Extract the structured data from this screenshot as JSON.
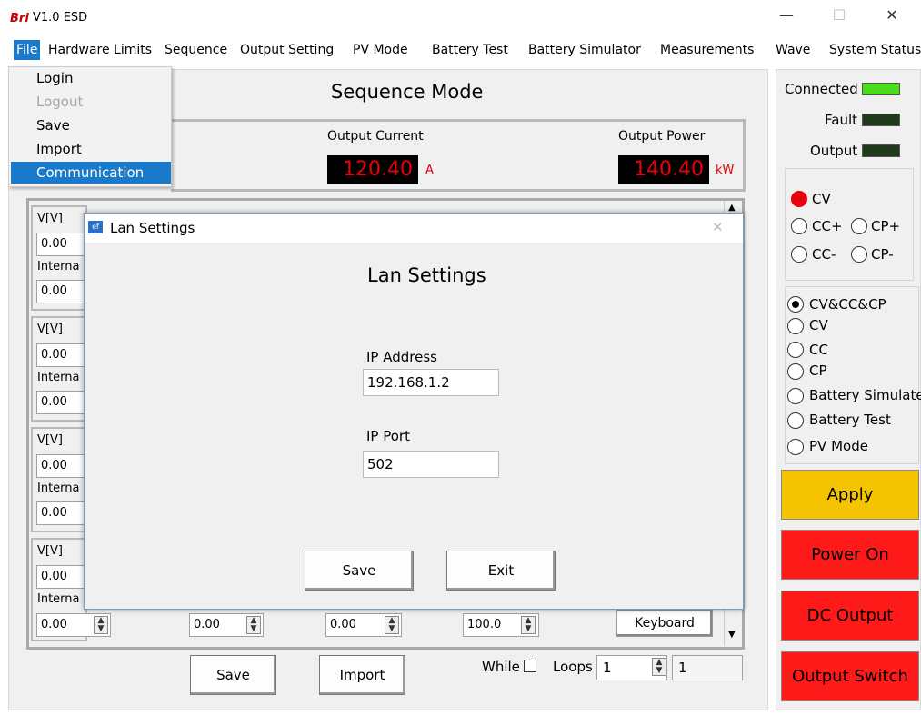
{
  "window": {
    "logo": "Bri",
    "title": "V1.0  ESD",
    "minimize": "—",
    "maximize": "☐",
    "close": "✕"
  },
  "menu": {
    "items": [
      "File",
      "Hardware Limits",
      "Sequence",
      "Output Setting",
      "PV Mode",
      "Battery Test",
      "Battery Simulator",
      "Measurements",
      "Wave",
      "System Status"
    ],
    "active": "File"
  },
  "file_menu": {
    "items": [
      {
        "label": "Login",
        "state": "normal"
      },
      {
        "label": "Logout",
        "state": "disabled"
      },
      {
        "label": "Save",
        "state": "normal"
      },
      {
        "label": "Import",
        "state": "normal"
      },
      {
        "label": "Communication",
        "state": "highlighted"
      }
    ]
  },
  "sequence": {
    "title": "Sequence Mode",
    "output_current_label": "Output Current",
    "output_current_value": "120.40",
    "output_current_unit": "A",
    "output_power_label": "Output Power",
    "output_power_value": "140.40",
    "output_power_unit": "kW",
    "rows": [
      {
        "v_label": "V[V]",
        "v_value": "0.00",
        "int_label": "Interna",
        "int_value": "0.00"
      },
      {
        "v_label": "V[V]",
        "v_value": "0.00",
        "int_label": "Interna",
        "int_value": "0.00"
      },
      {
        "v_label": "V[V]",
        "v_value": "0.00",
        "int_label": "Interna",
        "int_value": "0.00"
      },
      {
        "v_label": "V[V]",
        "v_value": "0.00",
        "int_label": "Interna",
        "int_value": ""
      }
    ],
    "bottom_inputs": [
      "0.00",
      "0.00",
      "0.00",
      "100.0"
    ],
    "keyboard_label": "Keyboard",
    "save_label": "Save",
    "import_label": "Import",
    "while_label": "While",
    "loops_label": "Loops",
    "loops_value": "1",
    "loops_display": "1"
  },
  "status": {
    "connected_label": "Connected",
    "fault_label": "Fault",
    "output_label": "Output",
    "colors": {
      "connected": "#4cdc1c",
      "fault": "#1f3a1a",
      "output": "#1f3a1a"
    }
  },
  "mode_group_1": {
    "options": [
      "CV",
      "CC+",
      "CP+",
      "CC-",
      "CP-"
    ],
    "selected": "CV"
  },
  "mode_group_2": {
    "options": [
      "CV&CC&CP",
      "CV",
      "CC",
      "CP",
      "Battery Simulate",
      "Battery Test",
      "PV Mode"
    ],
    "selected": "CV&CC&CP"
  },
  "actions": {
    "apply_label": "Apply",
    "power_on_label": "Power On",
    "dc_output_label": "DC Output",
    "output_switch_label": "Output Switch",
    "colors": {
      "apply": "#f5c400",
      "red": "#ff1a1a"
    }
  },
  "lan_dialog": {
    "window_title": "Lan Settings",
    "heading": "Lan Settings",
    "ip_address_label": "IP Address",
    "ip_address_value": "192.168.1.2",
    "ip_port_label": "IP Port",
    "ip_port_value": "502",
    "save_label": "Save",
    "exit_label": "Exit",
    "close_glyph": "✕"
  }
}
